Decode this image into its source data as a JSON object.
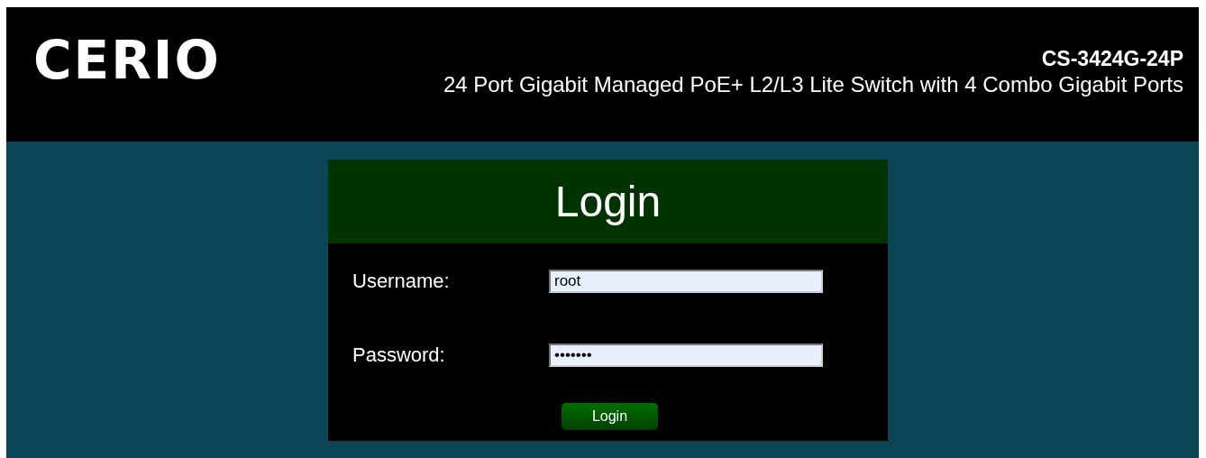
{
  "header": {
    "logo": "CERIO",
    "model": "CS-3424G-24P",
    "description": "24 Port Gigabit Managed PoE+ L2/L3 Lite Switch with 4 Combo Gigabit Ports"
  },
  "login": {
    "title": "Login",
    "fields": [
      {
        "label": "Username:",
        "value": "root"
      },
      {
        "label": "Password:",
        "value": "•••••••"
      }
    ],
    "button": "Login"
  }
}
